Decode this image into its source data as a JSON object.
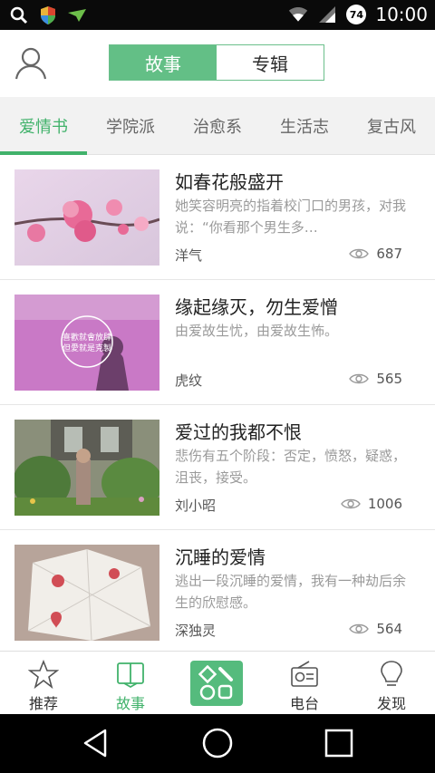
{
  "status_bar": {
    "time": "10:00",
    "battery": "74"
  },
  "header": {
    "segment": {
      "active": "故事",
      "inactive": "专辑"
    }
  },
  "tabs": [
    "爱情书",
    "学院派",
    "治愈系",
    "生活志",
    "复古风"
  ],
  "stories": [
    {
      "title": "如春花般盛开",
      "desc": "她笑容明亮的指着校门口的男孩，对我说：“你看那个男生多…",
      "author": "洋气",
      "views": "687"
    },
    {
      "title": "缘起缘灭，勿生爱憎",
      "desc": "由爱故生忧，由爱故生怖。",
      "author": "虎纹",
      "views": "565",
      "overlay_text_1": "喜歡就會放肆",
      "overlay_text_2": "但愛就是克製"
    },
    {
      "title": "爱过的我都不恨",
      "desc": "悲伤有五个阶段：否定，愤怒，疑惑，沮丧，接受。",
      "author": "刘小昭",
      "views": "1006"
    },
    {
      "title": "沉睡的爱情",
      "desc": "逃出一段沉睡的爱情，我有一种劫后余生的欣慰感。",
      "author": "深独灵",
      "views": "564"
    }
  ],
  "bottom_nav": [
    {
      "label": "推荐",
      "icon": "star-icon"
    },
    {
      "label": "故事",
      "icon": "book-icon"
    },
    {
      "label": "",
      "icon": "create-icon"
    },
    {
      "label": "电台",
      "icon": "radio-icon"
    },
    {
      "label": "发现",
      "icon": "bulb-icon"
    }
  ],
  "colors": {
    "accent": "#41b26b",
    "segment_active": "#63bf86"
  }
}
